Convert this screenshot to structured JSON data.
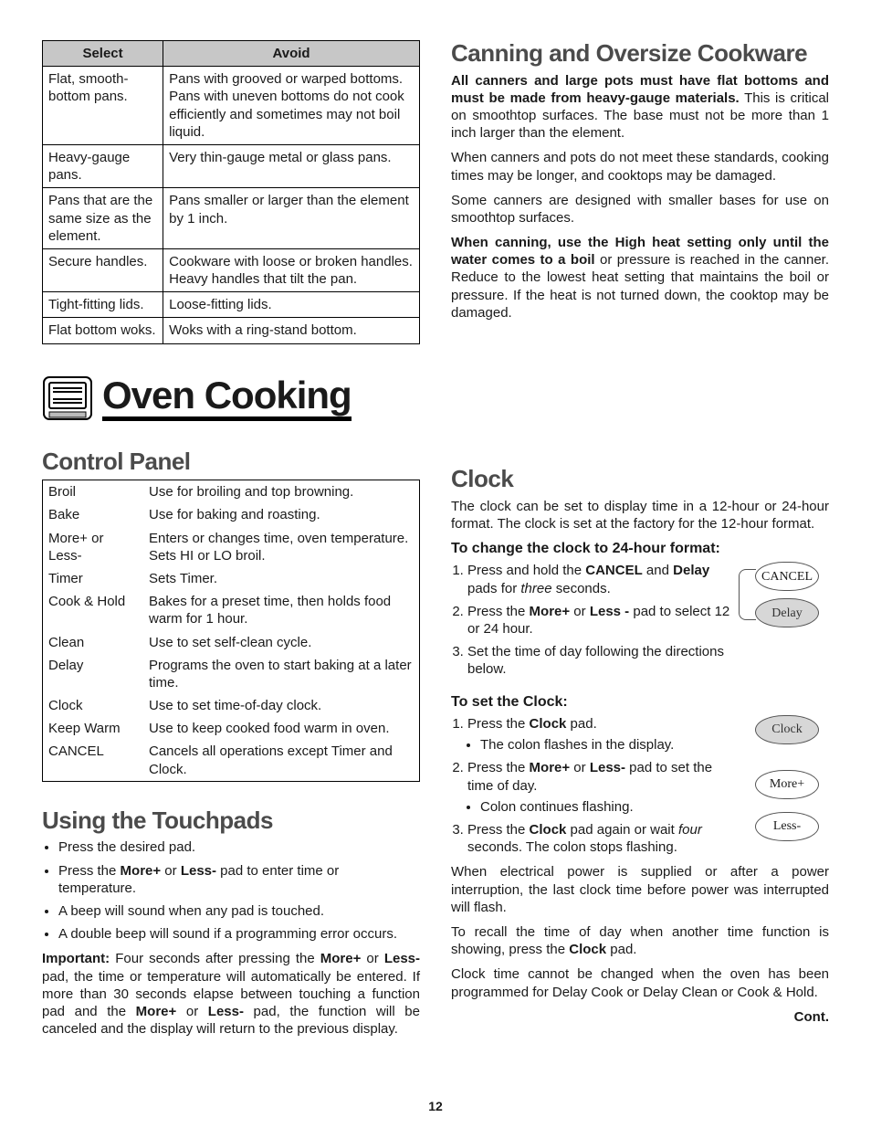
{
  "cookware_table": {
    "headers": [
      "Select",
      "Avoid"
    ],
    "rows": [
      [
        "Flat, smooth-bottom pans.",
        "Pans with grooved or warped bottoms. Pans with uneven bottoms do not cook efficiently and sometimes may not boil liquid."
      ],
      [
        "Heavy-gauge pans.",
        "Very thin-gauge metal or glass pans."
      ],
      [
        "Pans that are the same size as the element.",
        "Pans smaller or larger than the element by 1 inch."
      ],
      [
        "Secure handles.",
        "Cookware with loose or broken handles. Heavy handles that tilt the pan."
      ],
      [
        "Tight-fitting lids.",
        "Loose-fitting lids."
      ],
      [
        "Flat bottom woks.",
        "Woks with a ring-stand bottom."
      ]
    ]
  },
  "canning": {
    "heading": "Canning and Oversize Cookware",
    "p1_bold": "All canners and large pots must have flat bottoms and must be made from heavy-gauge materials.",
    "p1_rest": " This is critical on smoothtop surfaces. The base must not be more than 1 inch larger than the element.",
    "p2": "When canners and pots do not meet these standards, cooking times may be longer, and cooktops may be damaged.",
    "p3": "Some canners are designed with smaller bases for use on smoothtop surfaces.",
    "p4_bold": "When canning, use the High heat setting only until the water comes to a boil",
    "p4_rest": " or pressure is reached in the canner. Reduce to the lowest heat setting that maintains the boil or pressure. If the heat is not turned down, the cooktop may be damaged."
  },
  "banner": "Oven Cooking",
  "control_panel": {
    "heading": "Control Panel",
    "rows": [
      [
        "Broil",
        "Use for broiling and top browning."
      ],
      [
        "Bake",
        "Use for baking and roasting."
      ],
      [
        "More+ or Less-",
        "Enters or changes time, oven temperature. Sets HI or LO broil."
      ],
      [
        "Timer",
        "Sets Timer."
      ],
      [
        "Cook & Hold",
        "Bakes for a preset time, then holds food warm for 1 hour."
      ],
      [
        "Clean",
        "Use to set self-clean cycle."
      ],
      [
        "Delay",
        "Programs the oven to start baking at a later time."
      ],
      [
        "Clock",
        "Use to set time-of-day clock."
      ],
      [
        "Keep Warm",
        "Use to keep cooked food warm in oven."
      ],
      [
        "CANCEL",
        "Cancels all operations except Timer and Clock."
      ]
    ]
  },
  "touchpads": {
    "heading": "Using the Touchpads",
    "bullets": [
      "Press the desired pad.",
      "Press the <b>More+</b> or <b>Less-</b> pad to enter time or temperature.",
      "A beep will sound when any pad is touched.",
      "A double beep will sound if a programming error occurs."
    ],
    "important_label": "Important:",
    "important_text": " Four seconds after pressing the <b>More+</b> or <b>Less-</b> pad, the time or temperature will automatically be entered. If more than 30 seconds elapse between touching a function pad and the <b>More+</b> or <b>Less-</b> pad, the function will be canceled and the display will return to the previous display."
  },
  "clock": {
    "heading": "Clock",
    "intro": "The clock can be set to display time in a 12-hour or 24-hour format. The clock is set at the factory for the 12-hour format.",
    "sub1": "To change the clock to 24-hour format:",
    "steps1": [
      "Press and hold the <b>CANCEL</b> and <b>Delay</b> pads for <i>three</i> seconds.",
      "Press the <b>More+</b> or <b>Less -</b> pad to select 12 or 24 hour.",
      "Set the time of day following the directions below."
    ],
    "sub2": "To set the Clock:",
    "steps2": [
      {
        "t": "Press the <b>Clock</b> pad.",
        "sub": [
          "The colon flashes in the display."
        ]
      },
      {
        "t": "Press the <b>More+</b> or <b>Less-</b> pad to set the time of day.",
        "sub": [
          "Colon continues flashing."
        ]
      },
      {
        "t": "Press the <b>Clock</b> pad again or wait <i>four</i> seconds. The colon stops flashing.",
        "sub": []
      }
    ],
    "p_after1": "When electrical power is supplied or after a power interruption, the last clock time before power was interrupted will flash.",
    "p_after2": "To recall the time of day when another time function is showing, press the <b>Clock</b> pad.",
    "p_after3": "Clock time cannot be changed when the oven has been programmed for Delay Cook or Delay Clean or Cook & Hold."
  },
  "pads": {
    "cancel": "CANCEL",
    "delay": "Delay",
    "clock": "Clock",
    "more": "More+",
    "less": "Less-"
  },
  "cont": "Cont.",
  "pagenum": "12"
}
